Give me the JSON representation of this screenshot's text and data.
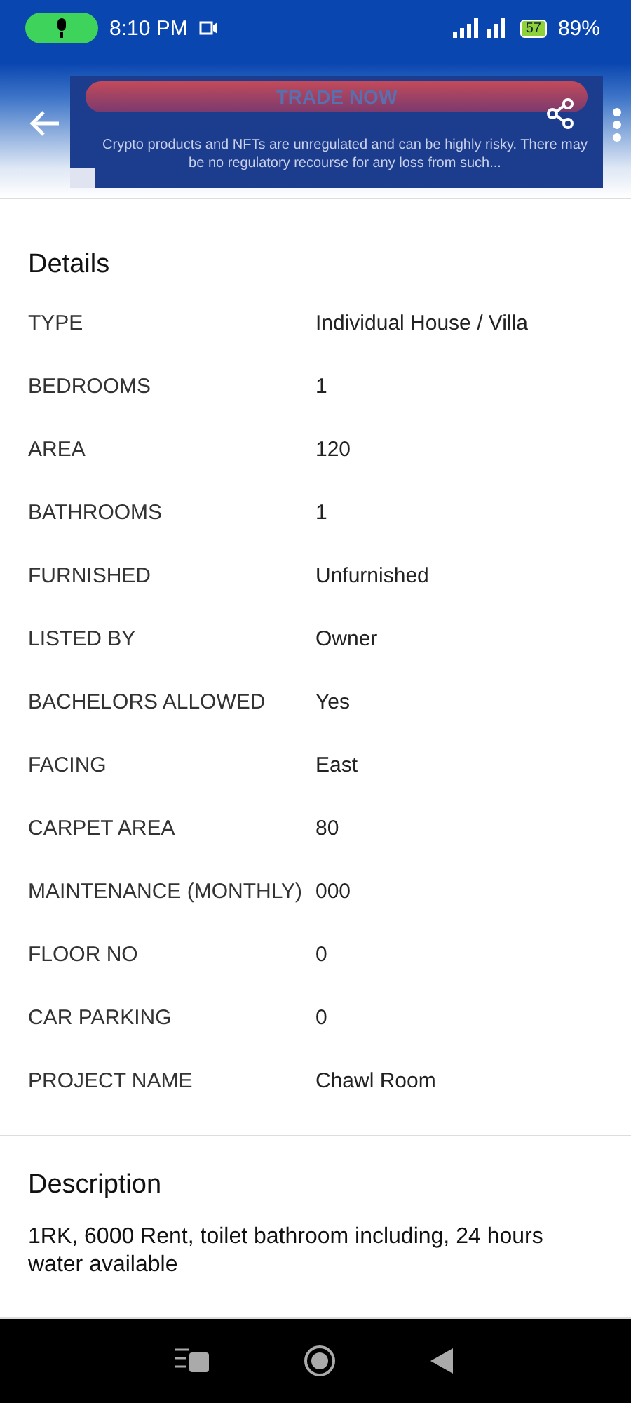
{
  "status_bar": {
    "time": "8:10 PM",
    "battery_badge": "57",
    "battery": "89%"
  },
  "ad": {
    "button": "TRADE NOW",
    "disclaimer": "Crypto products and NFTs are unregulated and can be highly risky. There may be no regulatory recourse for any loss from such..."
  },
  "details": {
    "title": "Details",
    "rows": [
      {
        "label": "TYPE",
        "value": "Individual House / Villa"
      },
      {
        "label": "BEDROOMS",
        "value": "1"
      },
      {
        "label": "AREA",
        "value": "120"
      },
      {
        "label": "BATHROOMS",
        "value": "1"
      },
      {
        "label": "FURNISHED",
        "value": "Unfurnished"
      },
      {
        "label": "LISTED BY",
        "value": "Owner"
      },
      {
        "label": "BACHELORS ALLOWED",
        "value": "Yes"
      },
      {
        "label": "FACING",
        "value": "East"
      },
      {
        "label": "CARPET AREA",
        "value": "80"
      },
      {
        "label": "MAINTENANCE (MONTHLY)",
        "value": "000"
      },
      {
        "label": "FLOOR NO",
        "value": "0"
      },
      {
        "label": "CAR PARKING",
        "value": "0"
      },
      {
        "label": "PROJECT NAME",
        "value": "Chawl Room"
      }
    ]
  },
  "description": {
    "title": "Description",
    "text": "1RK, 6000 Rent, toilet bathroom including, 24 hours water available"
  }
}
